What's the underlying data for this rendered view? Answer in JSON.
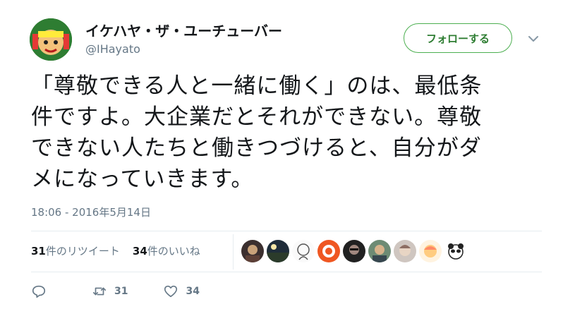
{
  "profile": {
    "display_name": "イケハヤ・ザ・ユーチューバー",
    "handle": "@IHayato"
  },
  "follow_label": "フォローする",
  "tweet": {
    "lines": [
      "「尊敬できる人と一緒に働く」のは、最低条",
      "件ですよ。大企業だとそれができない。尊敬",
      "できない人たちと働きつづけると、自分がダ",
      "メになっていきます。"
    ],
    "timestamp": "18:06 - 2016年5月14日"
  },
  "stats": {
    "retweets_count": "31",
    "retweets_label": "件のリツイート",
    "likes_count": "34",
    "likes_label": "件のいいね"
  },
  "likers": [
    "avatar-1",
    "avatar-2",
    "avatar-3",
    "avatar-4",
    "avatar-5",
    "avatar-6",
    "avatar-7",
    "avatar-8",
    "avatar-9"
  ],
  "actions": {
    "retweet_count": "31",
    "like_count": "34"
  },
  "colors": {
    "follow_border": "#4caf50",
    "follow_text": "#2e7d32",
    "muted": "#657786",
    "divider": "#e6ecf0"
  },
  "icons": {
    "reply": "reply-icon",
    "retweet": "retweet-icon",
    "like": "heart-icon",
    "menu": "chevron-down-icon"
  }
}
